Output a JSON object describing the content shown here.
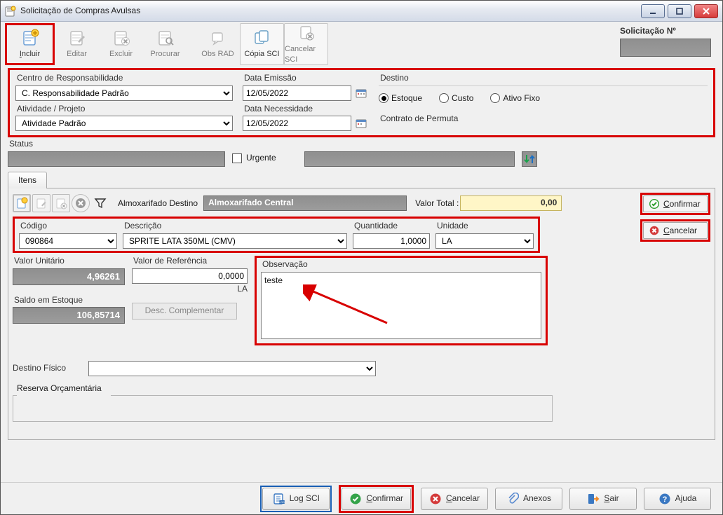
{
  "window": {
    "title": "Solicitação de Compras Avulsas"
  },
  "toolbar": {
    "incluir": "Incluir",
    "editar": "Editar",
    "excluir": "Excluir",
    "procurar": "Procurar",
    "obsrad": "Obs RAD",
    "copiasci": "Cópia SCI",
    "cancelarsci": "Cancelar SCI"
  },
  "solic": {
    "label": "Solicitação Nº",
    "value": ""
  },
  "header": {
    "centro_lbl": "Centro de Responsabilidade",
    "centro_val": "C. Responsabilidade Padrão",
    "atividade_lbl": "Atividade / Projeto",
    "atividade_val": "Atividade Padrão",
    "data_emissao_lbl": "Data Emissão",
    "data_emissao_val": "12/05/2022",
    "data_necessidade_lbl": "Data Necessidade",
    "data_necessidade_val": "12/05/2022",
    "destino_lbl": "Destino",
    "destino_opts": {
      "estoque": "Estoque",
      "custo": "Custo",
      "ativo": "Ativo Fixo"
    },
    "contrato_lbl": "Contrato de Permuta"
  },
  "status": {
    "label": "Status",
    "urgente": "Urgente"
  },
  "tabs": {
    "itens": "Itens"
  },
  "itemsbar": {
    "almox_lbl": "Almoxarifado Destino",
    "almox_val": "Almoxarifado Central",
    "valtotal_lbl": "Valor Total :",
    "valtotal_val": "0,00"
  },
  "item": {
    "codigo_lbl": "Código",
    "codigo_val": "090864",
    "descricao_lbl": "Descrição",
    "descricao_val": "SPRITE LATA 350ML (CMV)",
    "quantidade_lbl": "Quantidade",
    "quantidade_val": "1,0000",
    "unidade_lbl": "Unidade",
    "unidade_val": "LA",
    "valor_unit_lbl": "Valor Unitário",
    "valor_unit_val": "4,96261",
    "valor_ref_lbl": "Valor de Referência",
    "valor_ref_val": "0,0000",
    "unit_suffix": "LA",
    "saldo_lbl": "Saldo em Estoque",
    "saldo_val": "106,85714",
    "desc_compl": "Desc. Complementar",
    "obs_lbl": "Observação",
    "obs_val": "teste",
    "destino_fisico_lbl": "Destino Físico",
    "reserva_lbl": "Reserva Orçamentária"
  },
  "sidebtns": {
    "confirmar": "Confirmar",
    "cancelar": "Cancelar"
  },
  "footer": {
    "logsci": "Log SCI",
    "confirmar": "Confirmar",
    "cancelar": "Cancelar",
    "anexos": "Anexos",
    "sair": "Sair",
    "ajuda": "Ajuda"
  }
}
